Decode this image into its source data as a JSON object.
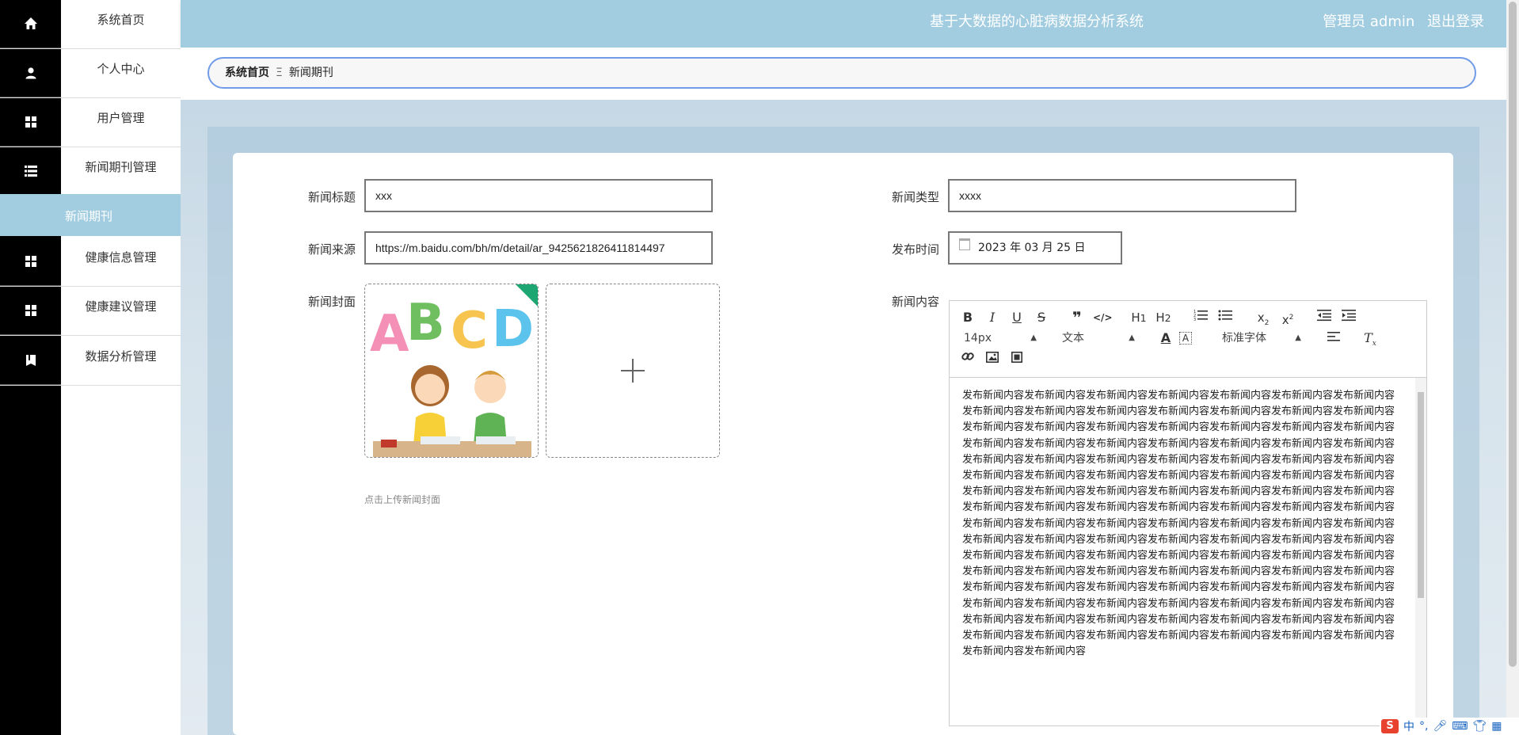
{
  "app": {
    "title": "基于大数据的心脏病数据分析系统",
    "user_label": "管理员 admin",
    "logout_label": "退出登录"
  },
  "sidebar": {
    "items": [
      {
        "label": "系统首页",
        "icon": "home-icon"
      },
      {
        "label": "个人中心",
        "icon": "user-icon"
      },
      {
        "label": "用户管理",
        "icon": "grid-icon"
      },
      {
        "label": "新闻期刊管理",
        "icon": "list-icon"
      },
      {
        "label": "新闻期刊",
        "icon": "",
        "active": true
      },
      {
        "label": "健康信息管理",
        "icon": "grid-icon"
      },
      {
        "label": "健康建议管理",
        "icon": "grid-icon"
      },
      {
        "label": "数据分析管理",
        "icon": "book-icon"
      }
    ]
  },
  "breadcrumb": {
    "home": "系统首页",
    "separator": "Ξ",
    "current": "新闻期刊"
  },
  "form": {
    "title_label": "新闻标题",
    "title_value": "xxx",
    "type_label": "新闻类型",
    "type_value": "xxxx",
    "source_label": "新闻来源",
    "source_value": "https://m.baidu.com/bh/m/detail/ar_9425621826411814497",
    "time_label": "发布时间",
    "time_value": "2023 年 03 月 25 日",
    "cover_label": "新闻封面",
    "cover_hint": "点击上传新闻封面",
    "content_label": "新闻内容"
  },
  "editor": {
    "font_size": "14px",
    "text_style": "文本",
    "font_family": "标准字体",
    "content": "发布新闻内容发布新闻内容发布新闻内容发布新闻内容发布新闻内容发布新闻内容发布新闻内容发布新闻内容发布新闻内容发布新闻内容发布新闻内容发布新闻内容发布新闻内容发布新闻内容发布新闻内容发布新闻内容发布新闻内容发布新闻内容发布新闻内容发布新闻内容发布新闻内容发布新闻内容发布新闻内容发布新闻内容发布新闻内容发布新闻内容发布新闻内容发布新闻内容发布新闻内容发布新闻内容发布新闻内容发布新闻内容发布新闻内容发布新闻内容发布新闻内容发布新闻内容发布新闻内容发布新闻内容发布新闻内容发布新闻内容发布新闻内容发布新闻内容发布新闻内容发布新闻内容发布新闻内容发布新闻内容发布新闻内容发布新闻内容发布新闻内容发布新闻内容发布新闻内容发布新闻内容发布新闻内容发布新闻内容发布新闻内容发布新闻内容发布新闻内容发布新闻内容发布新闻内容发布新闻内容发布新闻内容发布新闻内容发布新闻内容发布新闻内容发布新闻内容发布新闻内容发布新闻内容发布新闻内容发布新闻内容发布新闻内容发布新闻内容发布新闻内容发布新闻内容发布新闻内容发布新闻内容发布新闻内容发布新闻内容发布新闻内容发布新闻内容发布新闻内容发布新闻内容发布新闻内容发布新闻内容发布新闻内容发布新闻内容发布新闻内容发布新闻内容发布新闻内容发布新闻内容发布新闻内容发布新闻内容发布新闻内容发布新闻内容发布新闻内容发布新闻内容发布新闻内容发布新闻内容发布新闻内容发布新闻内容发布新闻内容发布新闻内容发布新闻内容发布新闻内容发布新闻内容发布新闻内容发布新闻内容发布新闻内容发布新闻内容发布新闻内容发布新闻内容发布新闻内容发布新闻内容发布新闻内容发布新闻内容"
  },
  "cover_image": {
    "letters": [
      "A",
      "B",
      "C",
      "D"
    ]
  },
  "ime": {
    "logo": "S",
    "lang": "中",
    "punct": "°,"
  },
  "colors": {
    "accent": "#a2cde0",
    "breadcrumb_border": "#6f9be8",
    "sidebar_rail": "#000000"
  }
}
